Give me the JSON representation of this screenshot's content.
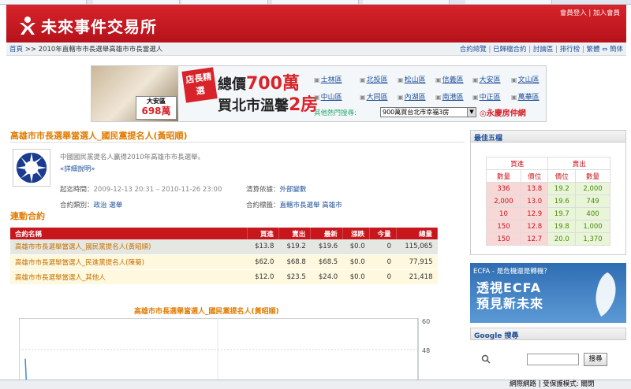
{
  "header": {
    "logo_text": "未來事件交易所",
    "member_login": "會員登入",
    "join": "加入會員",
    "sep": "|"
  },
  "breadcrumb": {
    "home": "首頁",
    "rest": ">> 2010年直轄市市長選舉高雄市市長當選人"
  },
  "navlinks": {
    "items": [
      "合約總覽",
      "已歸檔合約",
      "討論區",
      "排行榜",
      "繁體",
      "簡体"
    ],
    "switch": "⇔"
  },
  "banner": {
    "badge_area": "大安區",
    "badge_price": "698萬",
    "tag": "店長精選",
    "line1a": "總價",
    "line1b": "700萬",
    "line2a": "買北市溫馨",
    "line2b": "2房",
    "districts": [
      "士林區",
      "北投區",
      "松山區",
      "信義區",
      "大安區",
      "文山區",
      "中山區",
      "大同區",
      "內湖區",
      "南港區",
      "中正區",
      "萬華區"
    ],
    "search_label": "其他熱門搜尋:",
    "select_value": "900萬買台北市幸福3房",
    "brand": "◎永慶房仲網"
  },
  "contract": {
    "title": "高雄市市長選舉當選人_國民黨提名人(黃昭順)",
    "description": "中國國民黨提名人贏得2010年高雄市市長選舉。",
    "detail_link": "«詳細說明»",
    "period_label": "起迄時間：",
    "period_value": "2009-12-13 20:31 – 2010-11-26 23:00",
    "settle_label": "清算依據：",
    "settle_value": "外部變數",
    "category_label": "合約類別：",
    "category_value": "政治 選舉",
    "tags_label": "合約標籤：",
    "tags_value": "直轄市長選舉 高雄市"
  },
  "linked": {
    "title": "連動合約",
    "headers": [
      "合約名稱",
      "買進",
      "賣出",
      "最新",
      "漲跌",
      "今量",
      "總量"
    ],
    "rows": [
      {
        "name": "高雄市市長選舉當選人_國民黨提名人(黃昭順)",
        "buy": "$13.8",
        "sell": "$19.2",
        "last": "$19.6",
        "change": "$0.0",
        "today": "0",
        "total": "115,065"
      },
      {
        "name": "高雄市市長選舉當選人_民進黨提名人(陳菊)",
        "buy": "$62.0",
        "sell": "$68.8",
        "last": "$68.5",
        "change": "$0.0",
        "today": "0",
        "total": "77,915"
      },
      {
        "name": "高雄市市長選舉當選人_其他人",
        "buy": "$12.0",
        "sell": "$23.5",
        "last": "$24.0",
        "change": "$0.0",
        "today": "0",
        "total": "21,418"
      }
    ]
  },
  "chart": {
    "title": "高雄市市長選舉當選人_國民黨提名人(黃昭順)",
    "y_ticks": [
      "60",
      "48"
    ]
  },
  "chart_data": {
    "type": "line",
    "title": "高雄市市長選舉當選人_國民黨提名人(黃昭順)",
    "ylim": [
      0,
      60
    ],
    "y_ticks": [
      60,
      48
    ],
    "series": [
      {
        "values": [
          44,
          30
        ]
      }
    ]
  },
  "top5": {
    "title": "最佳五檔",
    "buy_group": "買進",
    "sell_group": "賣出",
    "cols": [
      "數量",
      "價位",
      "價位",
      "數量"
    ],
    "rows": [
      [
        "336",
        "13.8",
        "19.2",
        "2,000"
      ],
      [
        "2,000",
        "13.0",
        "19.6",
        "749"
      ],
      [
        "10",
        "12.9",
        "19.7",
        "400"
      ],
      [
        "150",
        "12.8",
        "19.8",
        "1,000"
      ],
      [
        "150",
        "12.7",
        "20.0",
        "1,370"
      ]
    ]
  },
  "ad": {
    "question": "ECFA - 是危機還是轉機？",
    "line1": "透視ECFA",
    "line2": "預見新未來"
  },
  "google": {
    "title": "Google 搜尋",
    "button": "搜尋"
  },
  "statusbar": {
    "zone": "網際網路 | 受保護模式: 關閉"
  },
  "colors": {
    "brand_red": "#c8161d",
    "accent_orange": "#e07b00",
    "link_blue": "#1e4f9a"
  }
}
